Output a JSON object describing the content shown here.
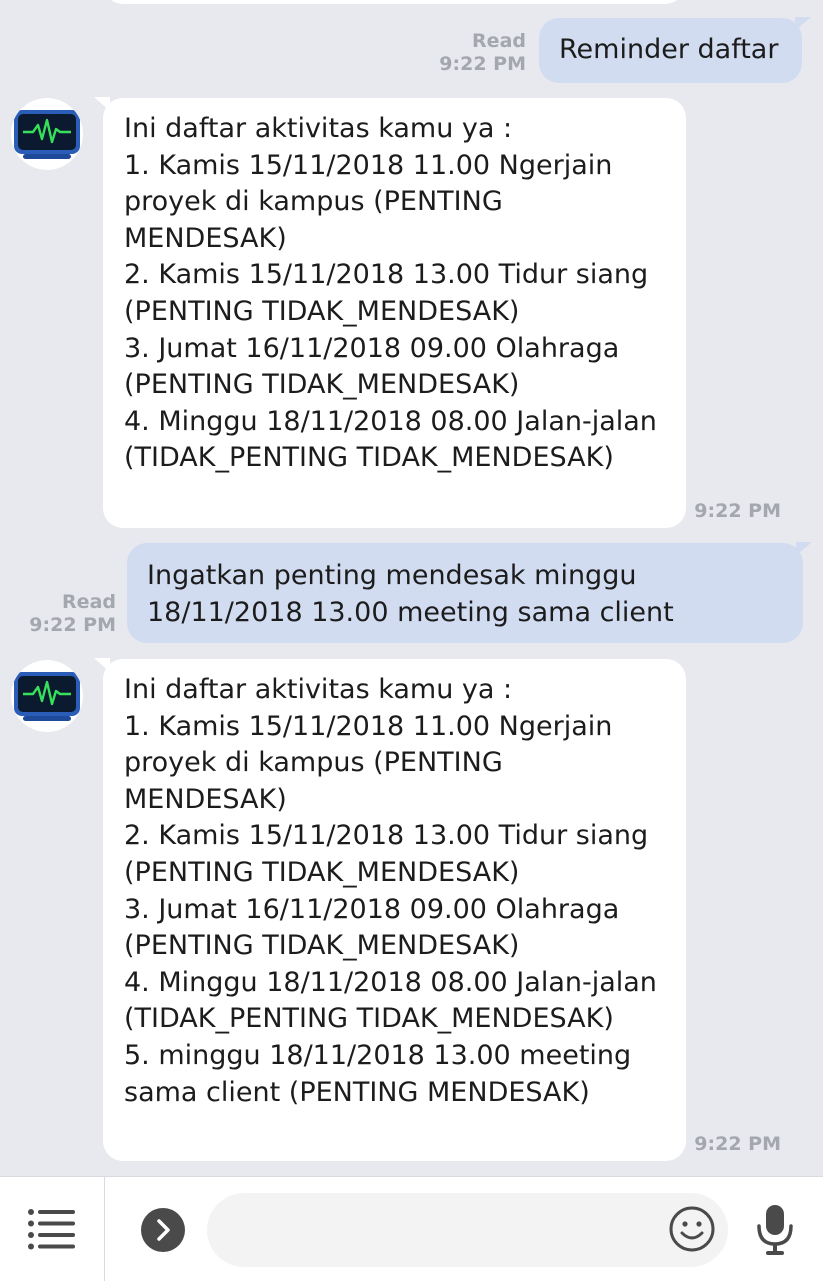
{
  "messages": [
    {
      "id": "m1",
      "direction": "outgoing",
      "text": "Reminder daftar",
      "status": "Read",
      "time": "9:22 PM"
    },
    {
      "id": "m2",
      "direction": "incoming",
      "sender_icon": "heartbeat-monitor-icon",
      "text": "Ini daftar aktivitas kamu ya :\n1. Kamis 15/11/2018 11.00 Ngerjain proyek di kampus (PENTING MENDESAK)\n2. Kamis 15/11/2018 13.00 Tidur siang (PENTING TIDAK_MENDESAK)\n3. Jumat 16/11/2018 09.00 Olahraga (PENTING TIDAK_MENDESAK)\n4. Minggu 18/11/2018 08.00 Jalan-jalan (TIDAK_PENTING TIDAK_MENDESAK)",
      "time": "9:22 PM"
    },
    {
      "id": "m3",
      "direction": "outgoing",
      "text": "Ingatkan penting mendesak minggu 18/11/2018 13.00 meeting sama client",
      "status": "Read",
      "time": "9:22 PM"
    },
    {
      "id": "m4",
      "direction": "incoming",
      "sender_icon": "heartbeat-monitor-icon",
      "text": "Ini daftar aktivitas kamu ya :\n1. Kamis 15/11/2018 11.00 Ngerjain proyek di kampus (PENTING MENDESAK)\n2. Kamis 15/11/2018 13.00 Tidur siang (PENTING TIDAK_MENDESAK)\n3. Jumat 16/11/2018 09.00 Olahraga (PENTING TIDAK_MENDESAK)\n4. Minggu 18/11/2018 08.00 Jalan-jalan (TIDAK_PENTING TIDAK_MENDESAK)\n5. minggu 18/11/2018 13.00 meeting sama client (PENTING MENDESAK)",
      "time": "9:22 PM"
    }
  ],
  "composer": {
    "value": "",
    "placeholder": "",
    "menu_icon": "menu-list-icon",
    "expand_icon": "chevron-right-icon",
    "emoji_icon": "smiley-icon",
    "mic_icon": "microphone-icon"
  },
  "colors": {
    "background": "#e7e9ee",
    "incoming_bubble": "#ffffff",
    "outgoing_bubble": "#d2dcf1",
    "meta_text": "#a4a7ad",
    "heartbeat_line": "#37e05a"
  }
}
